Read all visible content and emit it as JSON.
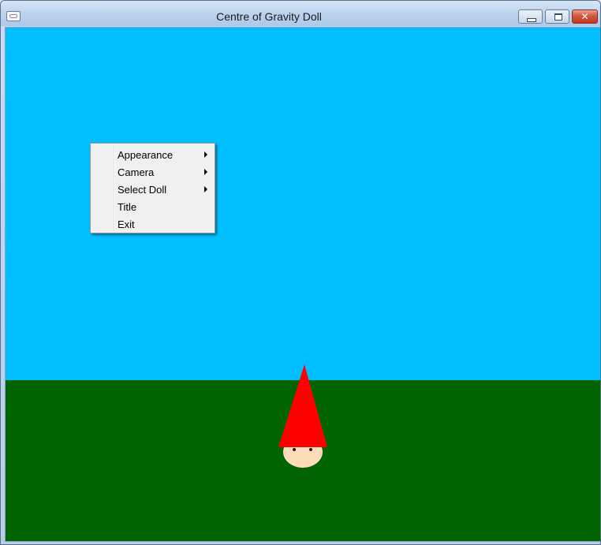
{
  "window": {
    "title": "Centre of Gravity Doll",
    "minimize_icon": "minimize-icon",
    "maximize_icon": "restore-icon",
    "close_icon": "close-icon",
    "close_glyph": "✕"
  },
  "scene": {
    "sky_color": "#00bfff",
    "ground_color": "#006400",
    "hat_color": "#ff0000",
    "face_color": "#ffdcb9"
  },
  "context_menu": {
    "items": [
      {
        "label": "Appearance",
        "submenu": true
      },
      {
        "label": "Camera",
        "submenu": true
      },
      {
        "label": "Select Doll",
        "submenu": true
      },
      {
        "label": "Title",
        "submenu": false
      },
      {
        "label": "Exit",
        "submenu": false
      }
    ]
  }
}
